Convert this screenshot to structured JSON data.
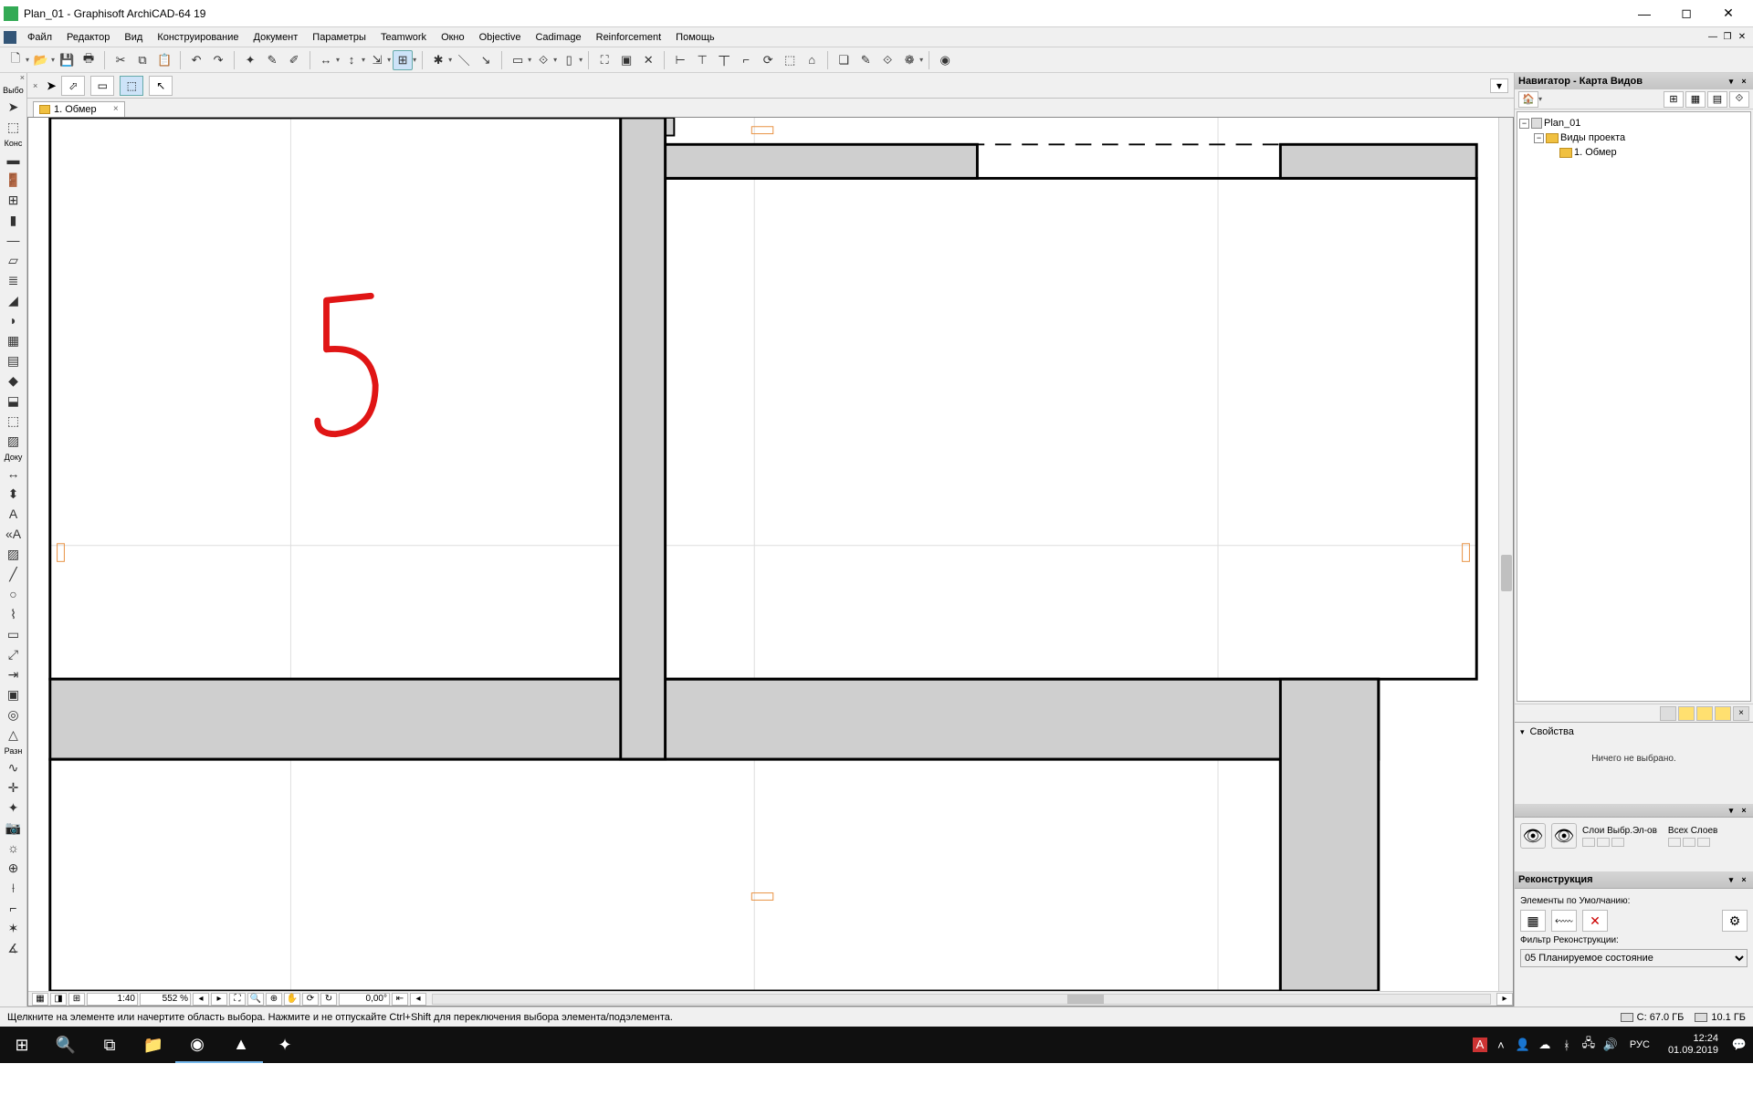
{
  "window": {
    "title": "Plan_01 - Graphisoft ArchiCAD-64 19"
  },
  "menu": {
    "items": [
      "Файл",
      "Редактор",
      "Вид",
      "Конструирование",
      "Документ",
      "Параметры",
      "Teamwork",
      "Окно",
      "Objective",
      "Cadimage",
      "Reinforcement",
      "Помощь"
    ]
  },
  "tab": {
    "label": "1. Обмер"
  },
  "statusbar": {
    "hint": "Щелкните на элементе или начертите область выбора. Нажмите и не отпускайте Ctrl+Shift для переключения выбора элемента/подэлемента.",
    "disk_c": "C: 67.0 ГБ",
    "disk_d": "10.1 ГБ"
  },
  "bottombar": {
    "scale": "1:40",
    "zoom": "552 %",
    "angle": "0,00°"
  },
  "navigator": {
    "title": "Навигатор - Карта Видов",
    "root": "Plan_01",
    "folder": "Виды проекта",
    "view": "1. Обмер"
  },
  "properties": {
    "header": "Свойства",
    "empty": "Ничего не выбрано."
  },
  "layers": {
    "col1": "Слои Выбр.Эл-ов",
    "col2": "Всех Слоев"
  },
  "recon": {
    "title": "Реконструкция",
    "sub1": "Элементы по Умолчанию:",
    "sub2": "Фильтр Реконструкции:",
    "filter": "05 Планируемое состояние"
  },
  "leftlabels": {
    "l1": "Выбо",
    "l2": "Конс",
    "l3": "Доку",
    "l4": "Разн"
  },
  "tray": {
    "lang": "РУС",
    "time": "12:24",
    "date": "01.09.2019"
  }
}
